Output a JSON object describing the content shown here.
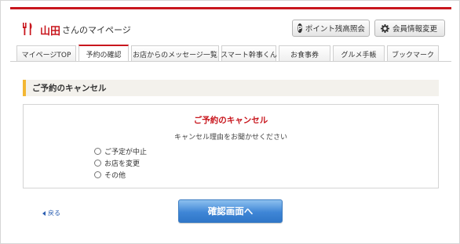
{
  "header": {
    "user_name": "山田",
    "page_label": "さんのマイページ",
    "points_button": "ポイント残高照会",
    "member_button": "会員情報変更",
    "points_icon_glyph": "P",
    "brand_color": "#c8161d"
  },
  "tabs": [
    {
      "label": "マイページTOP",
      "active": false
    },
    {
      "label": "予約の確認",
      "active": true
    },
    {
      "label": "お店からのメッセージ一覧",
      "active": false
    },
    {
      "label": "スマート幹事くん",
      "active": false
    },
    {
      "label": "お食事券",
      "active": false
    },
    {
      "label": "グルメ手帳",
      "active": false
    },
    {
      "label": "ブックマーク",
      "active": false
    }
  ],
  "section": {
    "title": "ご予約のキャンセル"
  },
  "panel": {
    "title": "ご予約のキャンセル",
    "subtitle": "キャンセル理由をお聞かせください",
    "options": [
      "ご予定が中止",
      "お店を変更",
      "その他"
    ]
  },
  "footer": {
    "back_label": "戻る",
    "confirm_label": "確認画面へ"
  }
}
